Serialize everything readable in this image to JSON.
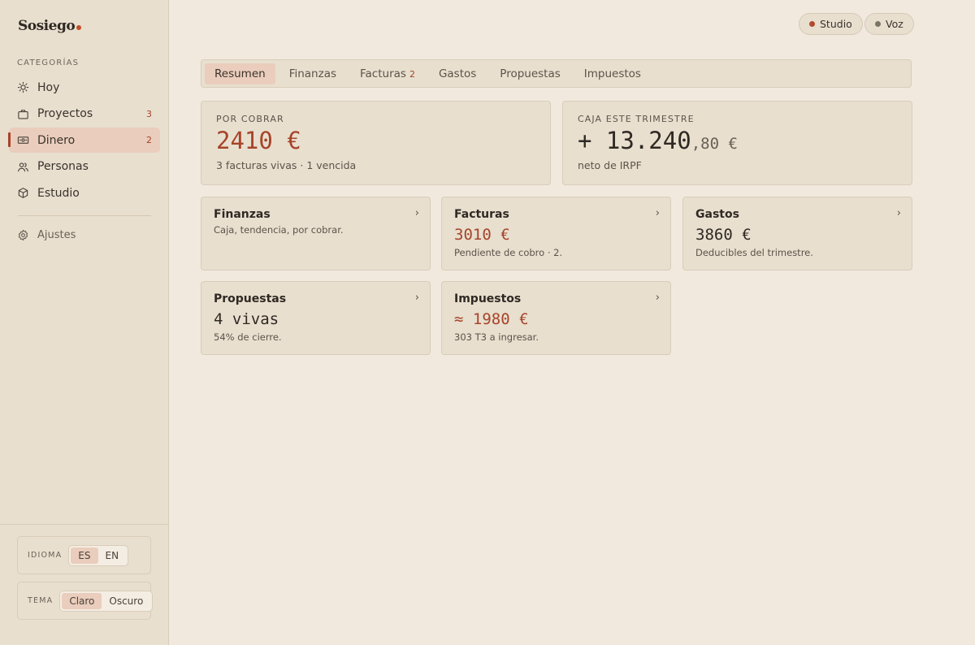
{
  "brand": {
    "name": "Sosiego",
    "dot_color": "#c0502a"
  },
  "sidebar": {
    "section_label": "CATEGORÍAS",
    "items": [
      {
        "label": "Hoy",
        "icon": "sun-icon",
        "count": ""
      },
      {
        "label": "Proyectos",
        "icon": "briefcase-icon",
        "count": "3"
      },
      {
        "label": "Dinero",
        "icon": "banknote-icon",
        "count": "2",
        "active": true
      },
      {
        "label": "Personas",
        "icon": "users-icon",
        "count": ""
      },
      {
        "label": "Estudio",
        "icon": "box-icon",
        "count": ""
      }
    ],
    "settings_label": "Ajustes",
    "language": {
      "label": "IDIOMA",
      "options": [
        "ES",
        "EN"
      ],
      "selected": "ES"
    },
    "theme": {
      "label": "TEMA",
      "options": [
        "Claro",
        "Oscuro"
      ],
      "selected": "Claro"
    }
  },
  "top_pills": [
    {
      "label": "Studio",
      "dot_color": "#b34a2c"
    },
    {
      "label": "Voz",
      "dot_color": "#7a7564"
    }
  ],
  "tabs": [
    {
      "label": "Resumen",
      "badge": "",
      "active": true
    },
    {
      "label": "Finanzas",
      "badge": ""
    },
    {
      "label": "Facturas",
      "badge": "2"
    },
    {
      "label": "Gastos",
      "badge": ""
    },
    {
      "label": "Propuestas",
      "badge": ""
    },
    {
      "label": "Impuestos",
      "badge": ""
    }
  ],
  "summary": {
    "receivable": {
      "label": "POR COBRAR",
      "value": "2410 €",
      "sub": "3 facturas vivas · 1 vencida"
    },
    "cash": {
      "label": "CAJA ESTE TRIMESTRE",
      "value": "+ 13.240",
      "cents": ",80 €",
      "sub": "neto de IRPF"
    }
  },
  "cards": {
    "finanzas": {
      "title": "Finanzas",
      "desc": "Caja, tendencia, por cobrar."
    },
    "facturas": {
      "title": "Facturas",
      "value": "3010 €",
      "sub": "Pendiente de cobro · 2."
    },
    "gastos": {
      "title": "Gastos",
      "value": "3860 €",
      "sub": "Deducibles del trimestre."
    },
    "propuestas": {
      "title": "Propuestas",
      "value": "4 vivas",
      "sub": "54% de cierre."
    },
    "impuestos": {
      "title": "Impuestos",
      "value": "≈ 1980 €",
      "sub": "303 T3 a ingresar."
    }
  },
  "chevron": "›",
  "colors": {
    "accent": "#a6442a",
    "background": "#f2e9de",
    "panel": "#e8dfcf",
    "active": "#eacdbc"
  }
}
